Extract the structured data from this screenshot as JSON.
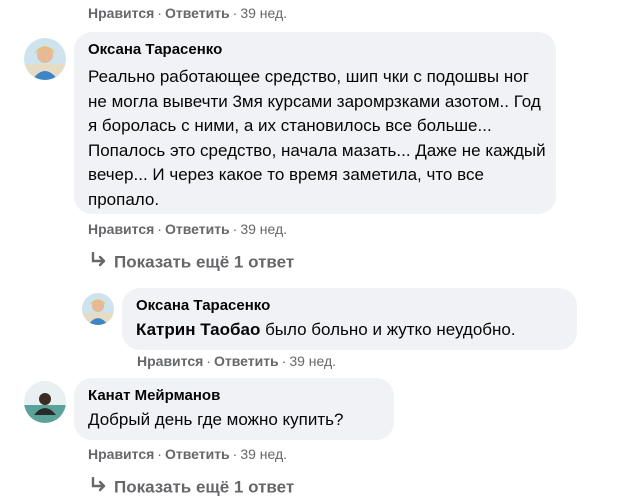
{
  "actions": {
    "like": "Нравится",
    "reply": "Ответить",
    "separator": "·"
  },
  "top_actions": {
    "time": "39 нед."
  },
  "comments": [
    {
      "author": "Оксана Тарасенко",
      "text": "Реально работающее средство, шип чки с подошвы ног не могла вывечти 3мя курсами заромрзками азотом.. Год я боролась с ними, а их становилось все больше... Попалось это средство, начала мазать... Даже не каждый вечер... И через какое то время заметила, что все пропало.",
      "time": "39 нед.",
      "more_replies": "Показать ещё 1 ответ",
      "reply": {
        "author": "Оксана Тарасенко",
        "mention": "Катрин Таобао",
        "text": " было больно и жутко неудобно.",
        "time": "39 нед."
      }
    },
    {
      "author": "Канат Мейрманов",
      "text": "Добрый день где можно купить?",
      "time": "39 нед.",
      "more_replies": "Показать ещё 1 ответ"
    }
  ],
  "colors": {
    "bubble": "#f0f2f5",
    "secondary_text": "#65676b",
    "primary_text": "#050505"
  },
  "icons": [
    "reply-arrow-icon",
    "avatar-photo"
  ]
}
